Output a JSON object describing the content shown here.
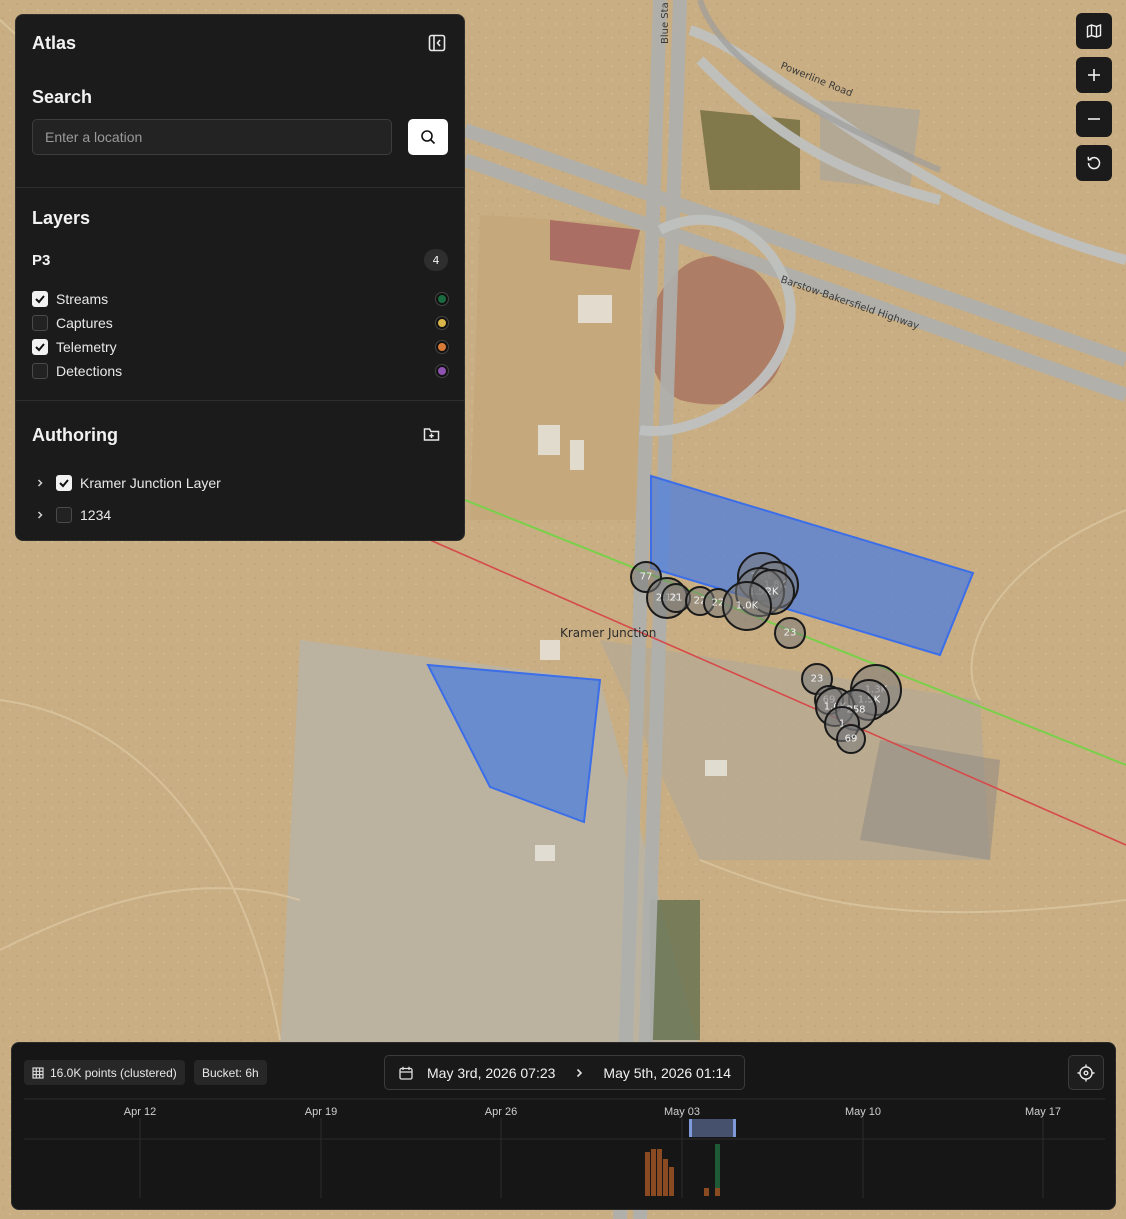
{
  "map": {
    "place_label": "Kramer Junction",
    "road_labels": [
      "Powerline Road",
      "Barstow-Bakersfield Highway",
      "Blue Sta"
    ],
    "clusters": [
      "77",
      "2.1K",
      "21",
      "22",
      "22",
      "2.8K",
      "1.8K",
      "1.5K",
      "2K",
      "1.0K",
      "23",
      "23",
      "1.3K",
      "1.5K",
      "69",
      "1.6K",
      "258",
      "1",
      "69"
    ],
    "polygon_color": "#4a7de0"
  },
  "panel": {
    "title": "Atlas",
    "collapse_icon": "panel-collapse-icon",
    "search": {
      "title": "Search",
      "placeholder": "Enter a location",
      "value": "",
      "button_icon": "search-icon"
    },
    "layers": {
      "title": "Layers",
      "group": {
        "name": "P3",
        "count": "4"
      },
      "items": [
        {
          "label": "Streams",
          "checked": true,
          "color": "#1a6b3f"
        },
        {
          "label": "Captures",
          "checked": false,
          "color": "#d8b64a"
        },
        {
          "label": "Telemetry",
          "checked": true,
          "color": "#d97b38"
        },
        {
          "label": "Detections",
          "checked": false,
          "color": "#8e52b0"
        }
      ]
    },
    "authoring": {
      "title": "Authoring",
      "add_icon": "folder-plus-icon",
      "items": [
        {
          "label": "Kramer Junction Layer",
          "checked": true
        },
        {
          "label": "1234",
          "checked": false
        }
      ]
    }
  },
  "controls": {
    "basemap_icon": "map-icon",
    "zoom_in_icon": "plus-icon",
    "zoom_out_icon": "minus-icon",
    "reset_icon": "rotate-icon"
  },
  "timeline": {
    "points_chip": "16.0K points (clustered)",
    "bucket_chip": "Bucket: 6h",
    "range_start": "May 3rd, 2026 07:23",
    "range_end": "May 5th, 2026 01:14",
    "ticks": [
      "Apr 12",
      "Apr 19",
      "Apr 26",
      "May 03",
      "May 10",
      "May 17"
    ],
    "colors": {
      "telemetry": "#8a4a22",
      "streams": "#1e5a36",
      "selection": "#7e9ad8"
    }
  }
}
